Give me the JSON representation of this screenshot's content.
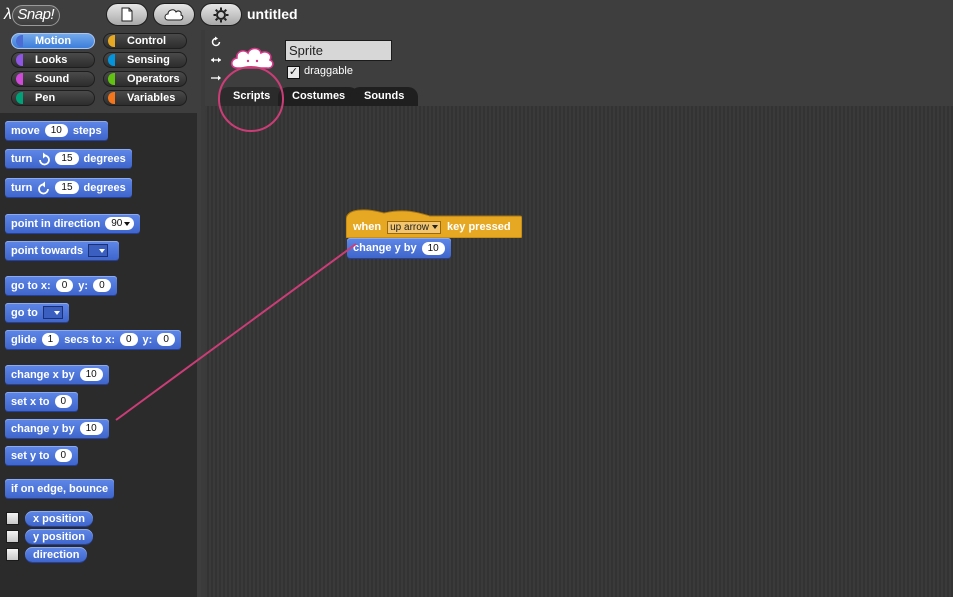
{
  "app": {
    "logo_text": "Snap!",
    "project_title": "untitled"
  },
  "categories": [
    {
      "label": "Motion",
      "color": "#4a6cd4",
      "selected": true
    },
    {
      "label": "Control",
      "color": "#e6a822"
    },
    {
      "label": "Looks",
      "color": "#8f56e3"
    },
    {
      "label": "Sensing",
      "color": "#0494dc"
    },
    {
      "label": "Sound",
      "color": "#cf4ad9"
    },
    {
      "label": "Operators",
      "color": "#62c213"
    },
    {
      "label": "Pen",
      "color": "#00a178"
    },
    {
      "label": "Variables",
      "color": "#f3761d"
    }
  ],
  "palette": {
    "move": {
      "pre": "move",
      "val": "10",
      "post": "steps"
    },
    "turn_cw": {
      "pre": "turn",
      "val": "15",
      "post": "degrees"
    },
    "turn_ccw": {
      "pre": "turn",
      "val": "15",
      "post": "degrees"
    },
    "point_dir": {
      "pre": "point in direction",
      "val": "90"
    },
    "point_towards": {
      "pre": "point towards"
    },
    "goto_xy": {
      "pre": "go to x:",
      "x": "0",
      "mid": "y:",
      "y": "0"
    },
    "goto": {
      "pre": "go to"
    },
    "glide": {
      "pre": "glide",
      "secs": "1",
      "mid1": "secs to x:",
      "x": "0",
      "mid2": "y:",
      "y": "0"
    },
    "change_x": {
      "pre": "change x by",
      "val": "10"
    },
    "set_x": {
      "pre": "set x to",
      "val": "0"
    },
    "change_y": {
      "pre": "change y by",
      "val": "10"
    },
    "set_y": {
      "pre": "set y to",
      "val": "0"
    },
    "bounce": {
      "label": "if on edge, bounce"
    },
    "x_position": "x position",
    "y_position": "y position",
    "direction": "direction"
  },
  "sprite": {
    "name": "Sprite",
    "draggable_label": "draggable",
    "draggable_checked": "✓"
  },
  "tabs": [
    "Scripts",
    "Costumes",
    "Sounds"
  ],
  "script": {
    "hat": {
      "pre": "when",
      "key": "up arrow",
      "post": "key pressed"
    },
    "command": {
      "pre": "change y by",
      "val": "10"
    }
  },
  "colors": {
    "motion": "#4a6cd4",
    "control": "#e6a822",
    "annotation": "#cc3d77"
  }
}
